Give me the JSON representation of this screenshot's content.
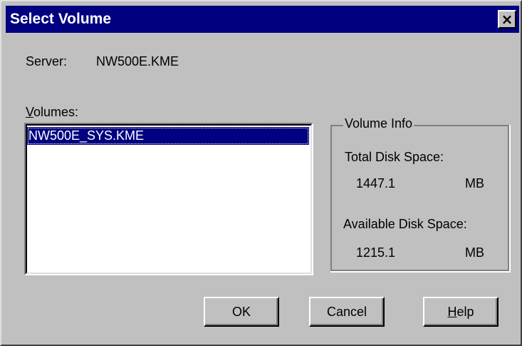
{
  "window": {
    "title": "Select Volume",
    "close_label": "×"
  },
  "server": {
    "label": "Server:",
    "value": "NW500E.KME"
  },
  "volumes": {
    "label_mnemonic": "V",
    "label_rest": "olumes:",
    "items": [
      "NW500E_SYS.KME"
    ],
    "selected_index": 0
  },
  "volume_info": {
    "title": "Volume Info",
    "total_label": "Total Disk Space:",
    "total_value": "1447.1",
    "total_unit": "MB",
    "available_label": "Available Disk Space:",
    "available_value": "1215.1",
    "available_unit": "MB"
  },
  "buttons": {
    "ok": "OK",
    "cancel": "Cancel",
    "help_mnemonic": "H",
    "help_rest": "elp"
  },
  "colors": {
    "titlebar": "#000080",
    "face": "#c0c0c0",
    "selection": "#000080"
  }
}
